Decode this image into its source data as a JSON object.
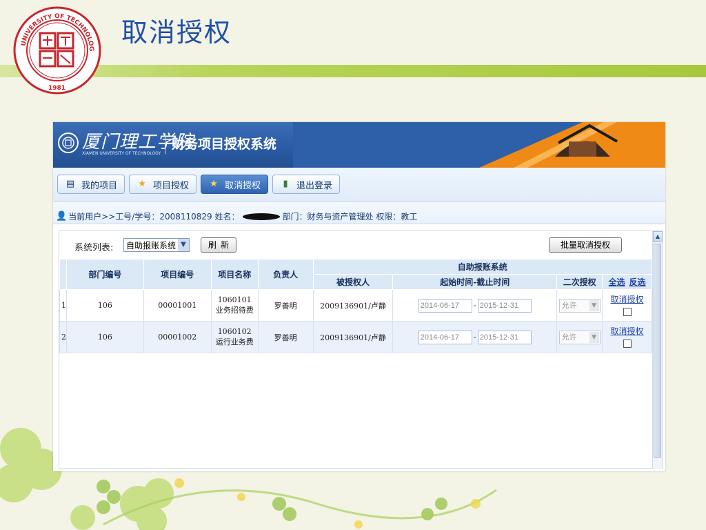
{
  "slide": {
    "title": "取消授权",
    "logo": {
      "icon": "university-seal-icon",
      "text": "XIAMEN UNIVERSITY OF TECHNOLOGY",
      "year": "1981",
      "color": "#c8252c"
    }
  },
  "app": {
    "school_name": "厦门理工学院",
    "school_name_en": "XIAMEN UNIVERSITY OF TECHNOLOGY",
    "system_title": "财务项目授权系统",
    "toolbar": [
      {
        "label": "我的项目",
        "icon": "document-icon",
        "active": false
      },
      {
        "label": "项目授权",
        "icon": "star-icon",
        "active": false
      },
      {
        "label": "取消授权",
        "icon": "star-cancel-icon",
        "active": true
      },
      {
        "label": "退出登录",
        "icon": "logout-icon",
        "active": false
      }
    ],
    "userbar": {
      "prefix": "当前用户>>工号/学号：2008110829 姓名：",
      "suffix": "部门：财务与资产管理处  权限：教工"
    },
    "controls": {
      "system_list_label": "系统列表:",
      "system_select_value": "自助报账系统",
      "refresh_label": "刷新",
      "batch_cancel_label": "批量取消授权"
    },
    "table": {
      "group_header": "自助报账系统",
      "headers": {
        "dept": "部门编号",
        "project_no": "项目编号",
        "project_name": "项目名称",
        "owner": "负责人",
        "grantee": "被授权人",
        "period": "起始时间-截止时间",
        "second_grant": "二次授权",
        "select_all": "全选",
        "invert": "反选"
      },
      "rows": [
        {
          "index": "1",
          "dept": "106",
          "project_no": "00001001",
          "project_name": "1060101业务招待费",
          "owner": "罗善明",
          "grantee": "2009136901/卢静",
          "start": "2014-06-17",
          "end": "2015-12-31",
          "second_grant": "允许",
          "action": "取消授权"
        },
        {
          "index": "2",
          "dept": "106",
          "project_no": "00001002",
          "project_name": "1060102运行业务费",
          "owner": "罗善明",
          "grantee": "2009136901/卢静",
          "start": "2014-06-17",
          "end": "2015-12-31",
          "second_grant": "允许",
          "action": "取消授权"
        }
      ]
    },
    "colors": {
      "header_blue": "#2a5aa3",
      "link_blue": "#1d3fa3",
      "accent_green": "#a8c83c",
      "title_blue": "#1f4fa8"
    }
  }
}
